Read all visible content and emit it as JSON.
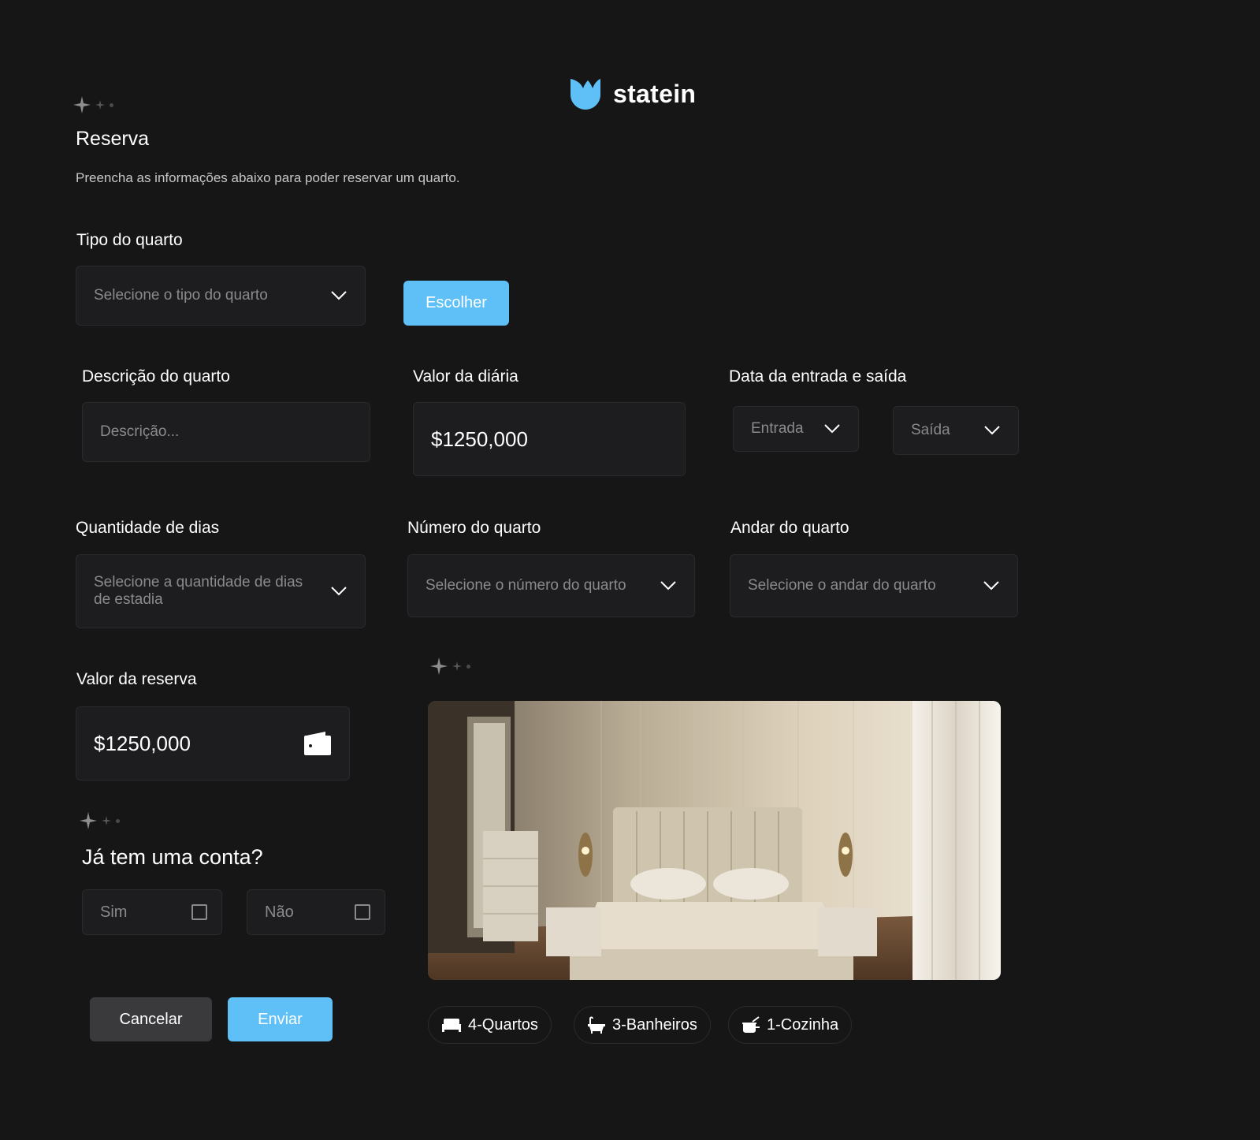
{
  "brand": {
    "name": "statein",
    "logo_icon": "tulip-logo-icon",
    "accent": "#5ec0f7"
  },
  "header": {
    "title": "Reserva",
    "subtitle": "Preencha as informações abaixo para poder reservar um quarto."
  },
  "room_type": {
    "label": "Tipo do quarto",
    "placeholder": "Selecione o tipo do quarto",
    "choose_button": "Escolher"
  },
  "description": {
    "label": "Descrição do quarto",
    "placeholder": "Descrição..."
  },
  "daily_rate": {
    "label": "Valor da diária",
    "value": "$1250,000"
  },
  "dates": {
    "label": "Data da entrada e saída",
    "checkin": "Entrada",
    "checkout": "Saída"
  },
  "days": {
    "label": "Quantidade de dias",
    "placeholder": "Selecione a quantidade de dias de estadia"
  },
  "room_number": {
    "label": "Número do quarto",
    "placeholder": "Selecione o número do quarto"
  },
  "floor": {
    "label": "Andar do quarto",
    "placeholder": "Selecione o andar do quarto"
  },
  "reservation_value": {
    "label": "Valor da reserva",
    "value": "$1250,000",
    "icon": "wallet-icon"
  },
  "account": {
    "question": "Já tem uma conta?",
    "yes": "Sim",
    "no": "Não"
  },
  "actions": {
    "cancel": "Cancelar",
    "submit": "Enviar"
  },
  "features": [
    {
      "icon": "bed-icon",
      "label": "4-Quartos"
    },
    {
      "icon": "bathtub-icon",
      "label": "3-Banheiros"
    },
    {
      "icon": "kitchen-icon",
      "label": "1-Cozinha"
    }
  ],
  "colors": {
    "background": "#161617",
    "field": "#1d1d1f",
    "primary": "#5ec0f7",
    "secondary": "#3a3a3c"
  }
}
